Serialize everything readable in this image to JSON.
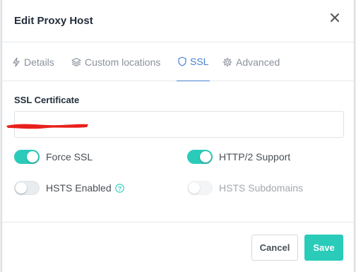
{
  "dialog": {
    "title": "Edit Proxy Host",
    "close_icon": "close-icon"
  },
  "tabs": [
    {
      "label": "Details",
      "icon": "bolt-icon",
      "active": false
    },
    {
      "label": "Custom locations",
      "icon": "layers-icon",
      "active": false
    },
    {
      "label": "SSL",
      "icon": "shield-icon",
      "active": true
    },
    {
      "label": "Advanced",
      "icon": "gear-icon",
      "active": false
    }
  ],
  "ssl": {
    "certificate_label": "SSL Certificate",
    "certificate_value": "",
    "toggles": {
      "force_ssl": {
        "label": "Force SSL",
        "on": true
      },
      "http2": {
        "label": "HTTP/2 Support",
        "on": true
      },
      "hsts": {
        "label": "HSTS Enabled",
        "on": false
      },
      "hsts_subdomains": {
        "label": "HSTS Subdomains",
        "on": false,
        "disabled": true
      }
    }
  },
  "footer": {
    "cancel_label": "Cancel",
    "save_label": "Save"
  },
  "colors": {
    "accent": "#2bcbba",
    "active_tab": "#467fcf",
    "redaction": "#e8201c"
  }
}
